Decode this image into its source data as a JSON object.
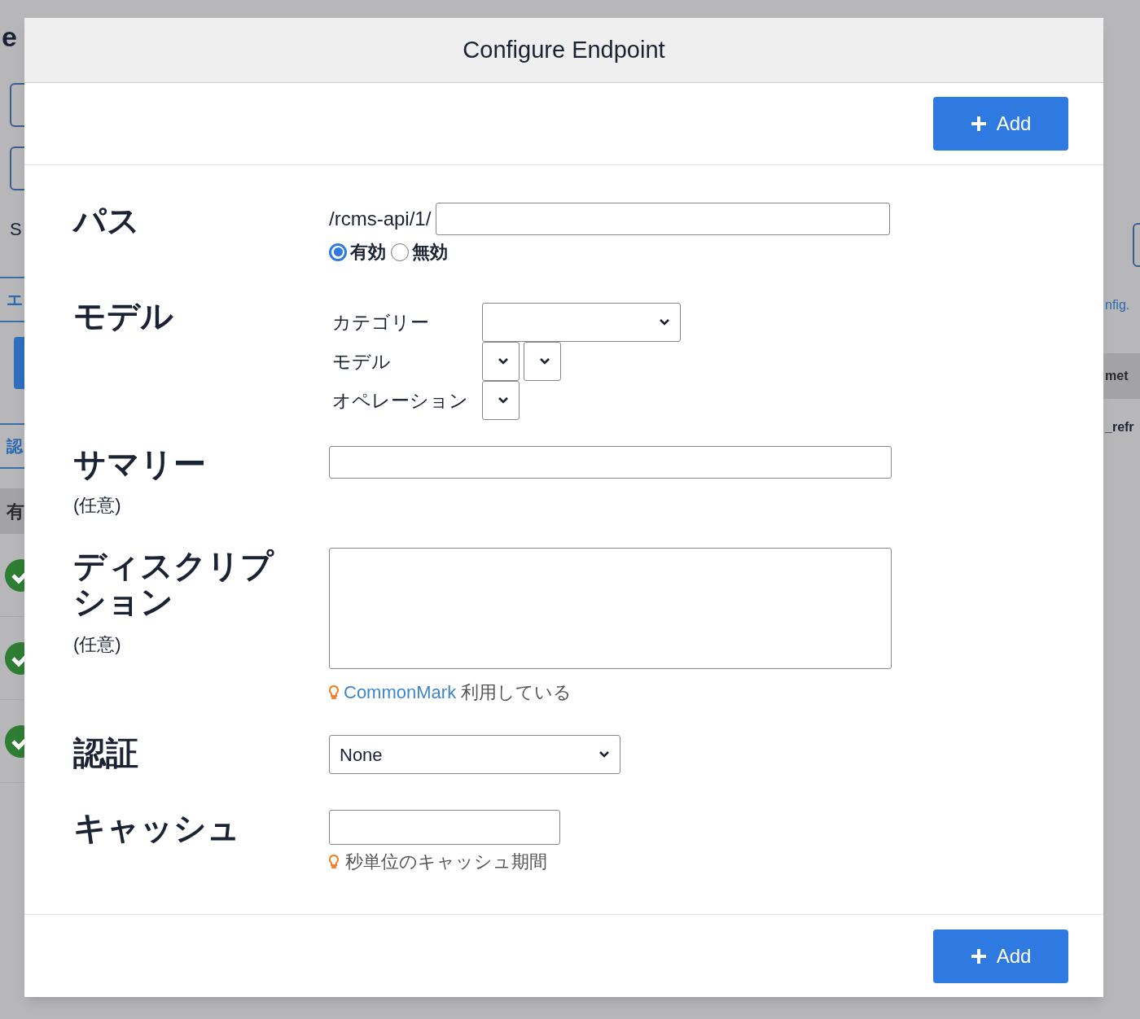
{
  "background": {
    "left": [
      {
        "kind": "heading",
        "text": "e"
      },
      {
        "kind": "field"
      },
      {
        "kind": "field"
      },
      {
        "kind": "text",
        "text": "S"
      },
      {
        "kind": "tab",
        "text": "エ"
      },
      {
        "kind": "button"
      },
      {
        "kind": "tab",
        "text": "認"
      },
      {
        "kind": "header",
        "text": "有"
      },
      {
        "kind": "check"
      },
      {
        "kind": "check"
      },
      {
        "kind": "check"
      }
    ],
    "right": [
      {
        "kind": "field"
      },
      {
        "kind": "link",
        "text": "nfig."
      },
      {
        "kind": "header",
        "text": "met"
      },
      {
        "kind": "text",
        "text": "_refr"
      }
    ]
  },
  "dialog": {
    "title": "Configure Endpoint",
    "top_button": "Add",
    "bottom_button": "Add",
    "path": {
      "label": "パス",
      "prefix": "/rcms-api/1/",
      "radios": [
        {
          "label": "有効",
          "selected": true
        },
        {
          "label": "無効",
          "selected": false
        }
      ]
    },
    "model": {
      "label": "モデル",
      "rows": [
        {
          "label": "カテゴリー",
          "selects": [
            {
              "kind": "wide"
            }
          ]
        },
        {
          "label": "モデル",
          "selects": [
            {
              "kind": "narrow"
            },
            {
              "kind": "narrow"
            }
          ]
        },
        {
          "label": "オペレーション",
          "selects": [
            {
              "kind": "narrow"
            }
          ]
        }
      ]
    },
    "summary": {
      "label": "サマリー",
      "note": "(任意)"
    },
    "description": {
      "label": "ディスクリプション",
      "note": "(任意)",
      "hint_link": "CommonMark",
      "hint": "利用している"
    },
    "auth": {
      "label": "認証",
      "value": "None"
    },
    "cache": {
      "label": "キャッシュ",
      "hint": "秒単位のキャッシュ期間"
    }
  }
}
